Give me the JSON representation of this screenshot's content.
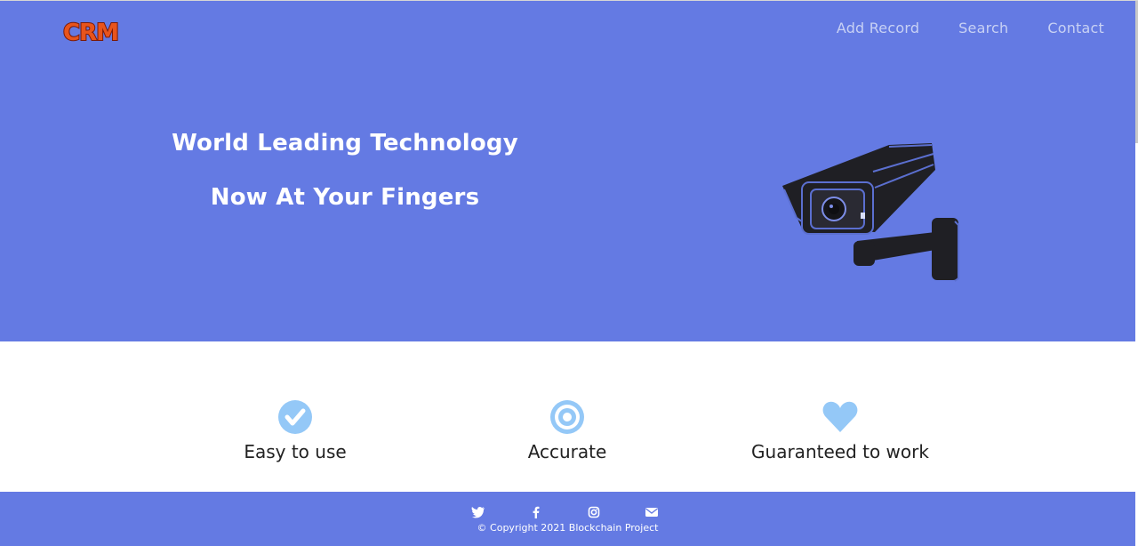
{
  "header": {
    "logo_text": "CRM",
    "nav": [
      {
        "label": "Add Record"
      },
      {
        "label": "Search"
      },
      {
        "label": "Contact"
      }
    ]
  },
  "hero": {
    "line1": "World Leading Technology",
    "line2": "Now At Your Fingers",
    "illustration": "security-camera"
  },
  "features": [
    {
      "icon": "check-circle-icon",
      "label": "Easy to use"
    },
    {
      "icon": "target-icon",
      "label": "Accurate"
    },
    {
      "icon": "heart-icon",
      "label": "Guaranteed to work"
    }
  ],
  "footer": {
    "social": [
      "twitter-icon",
      "facebook-icon",
      "instagram-icon",
      "email-icon"
    ],
    "copyright": "© Copyright 2021 Blockchain Project"
  },
  "colors": {
    "primary": "#647ae3",
    "icon_accent": "#94c8f7",
    "nav_text": "#c8d1f4"
  }
}
